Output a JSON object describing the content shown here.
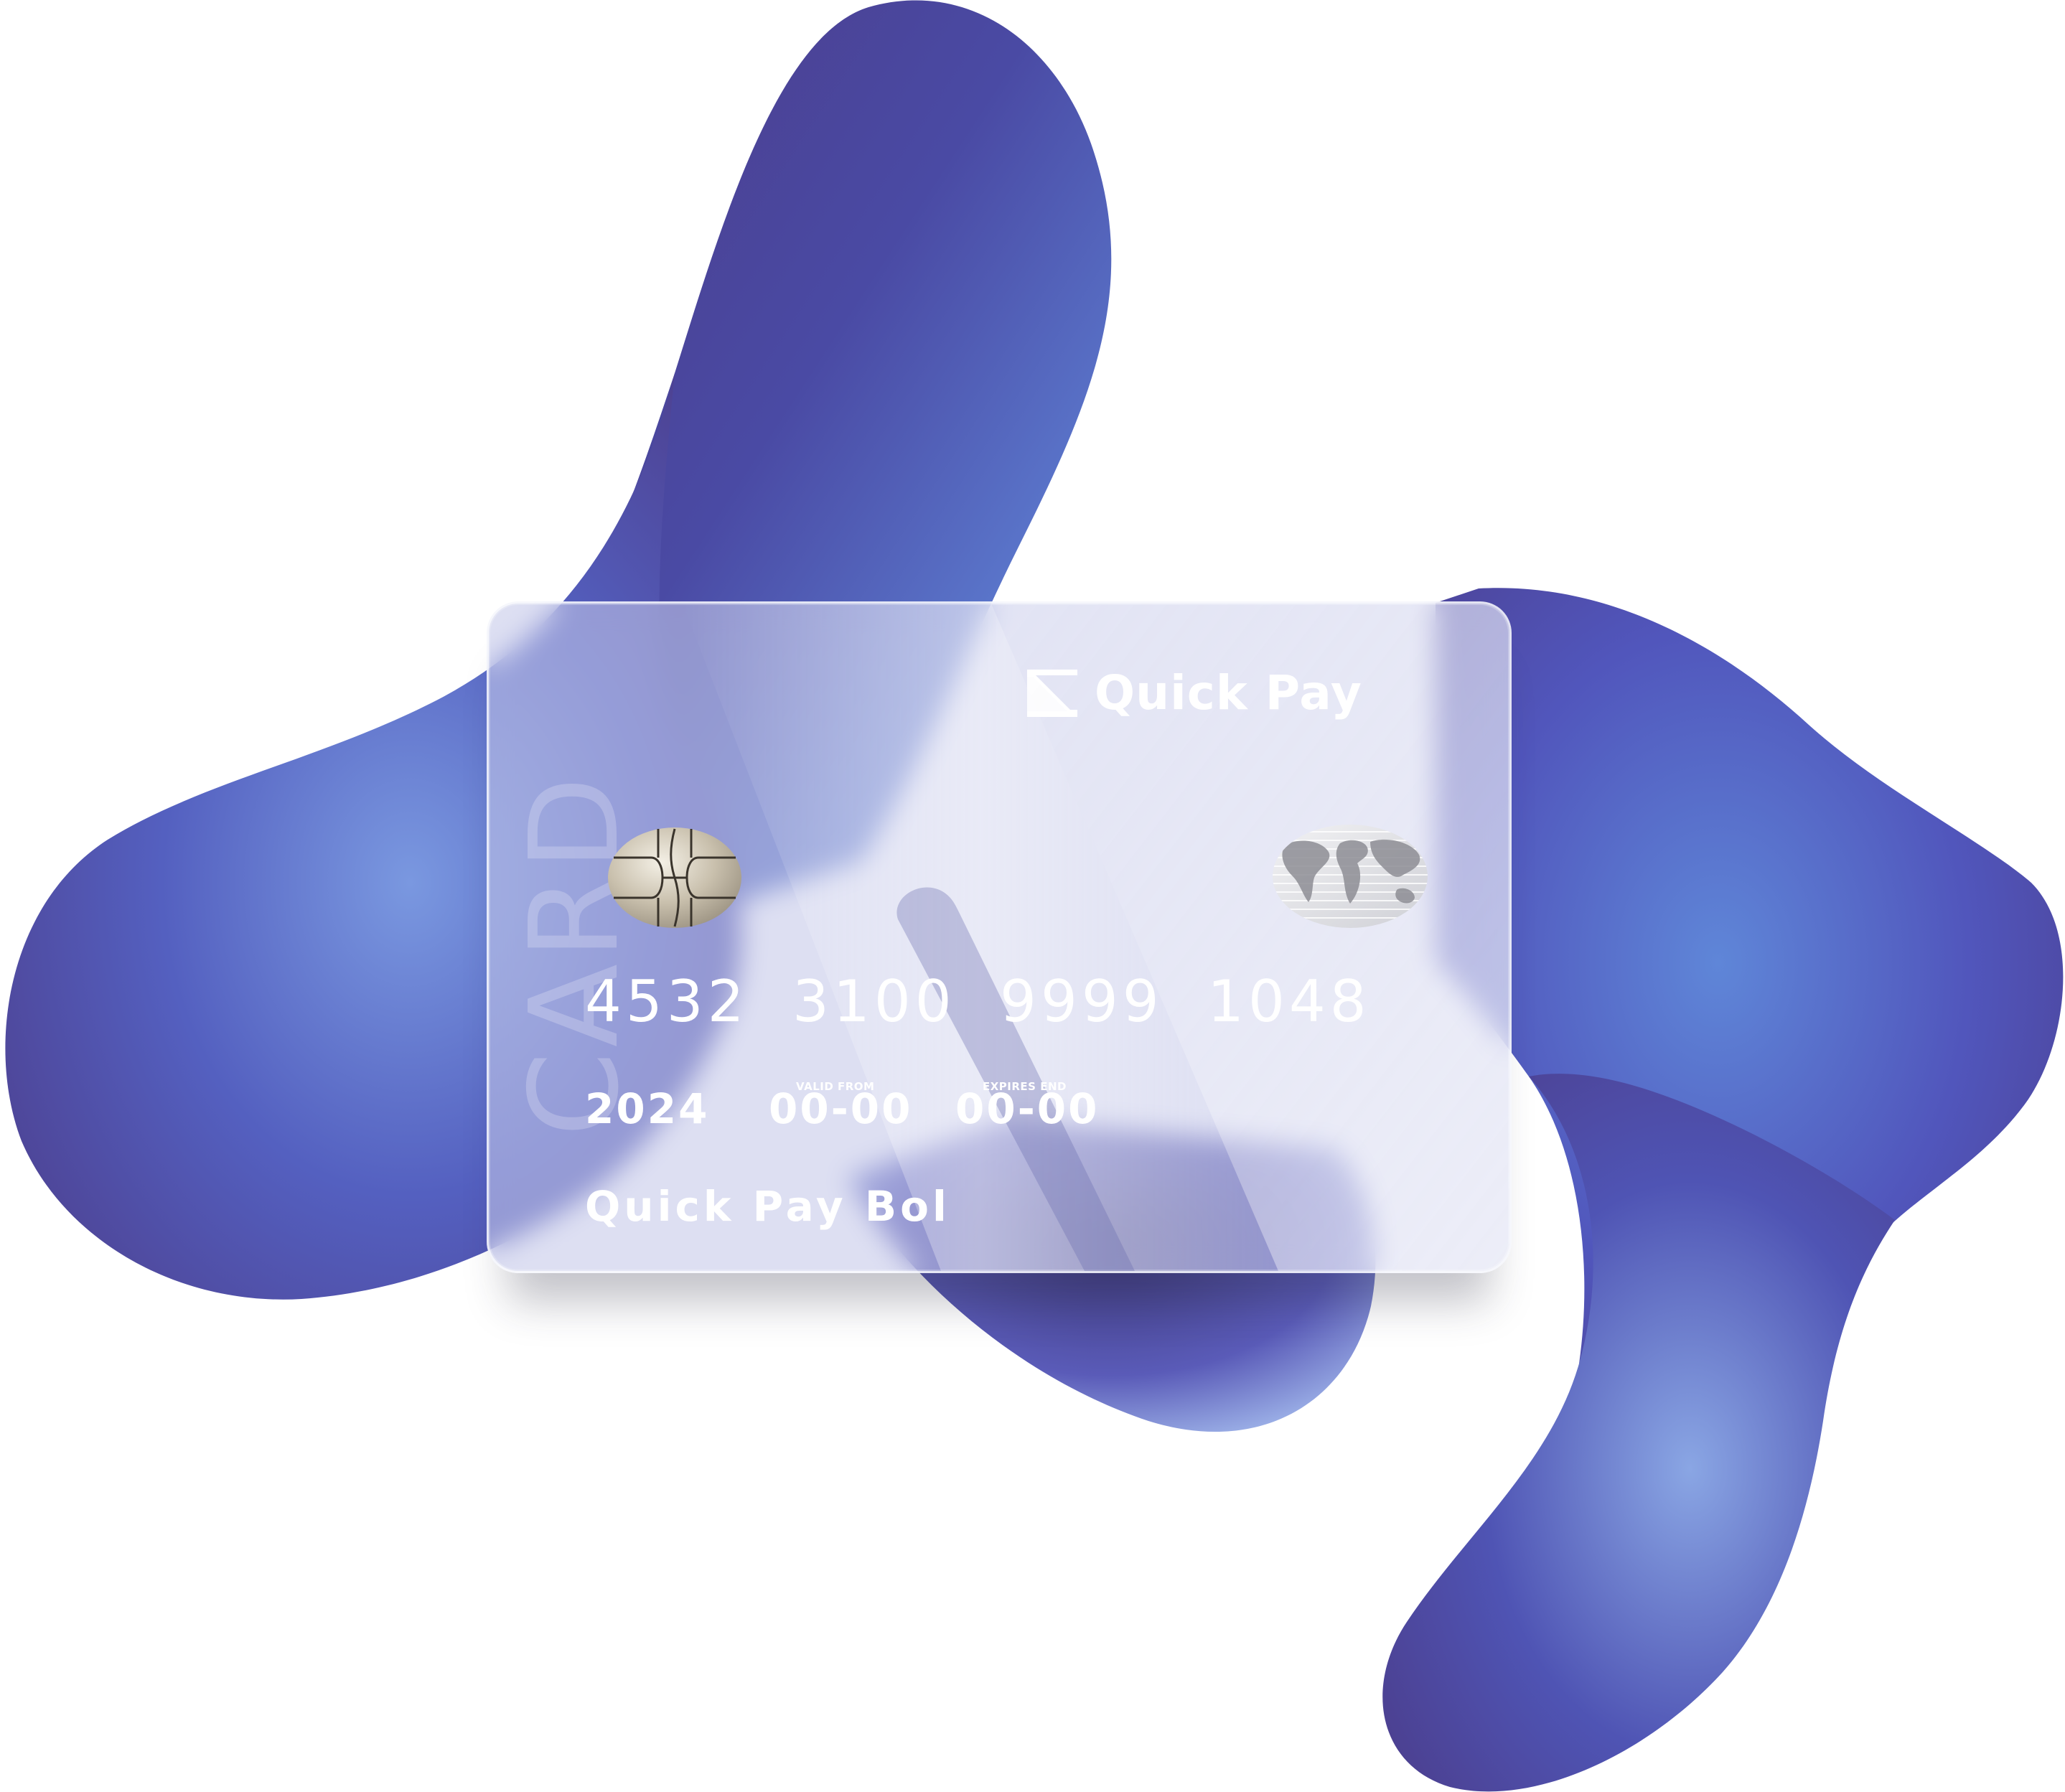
{
  "card": {
    "brand_name": "Quick Pay",
    "vertical_word": "CARD",
    "number": "4532 3100 9999 1048",
    "year": "2024",
    "valid_from_label": "VALID FROM",
    "valid_from": "00-00",
    "expires_end_label": "EXPIRES END",
    "expires_end": "00-00",
    "holder_name": "Quick Pay Bol"
  },
  "icons": {
    "brand_logo": "quick-pay-logo-icon",
    "chip": "emv-chip-icon",
    "hologram": "world-map-hologram-icon"
  },
  "colors": {
    "blob_dark": "#4b3a86",
    "blob_mid": "#4d52b4",
    "blob_light": "#6a8ad8",
    "card_tint": "#c4c8e8",
    "text": "#ffffff"
  }
}
